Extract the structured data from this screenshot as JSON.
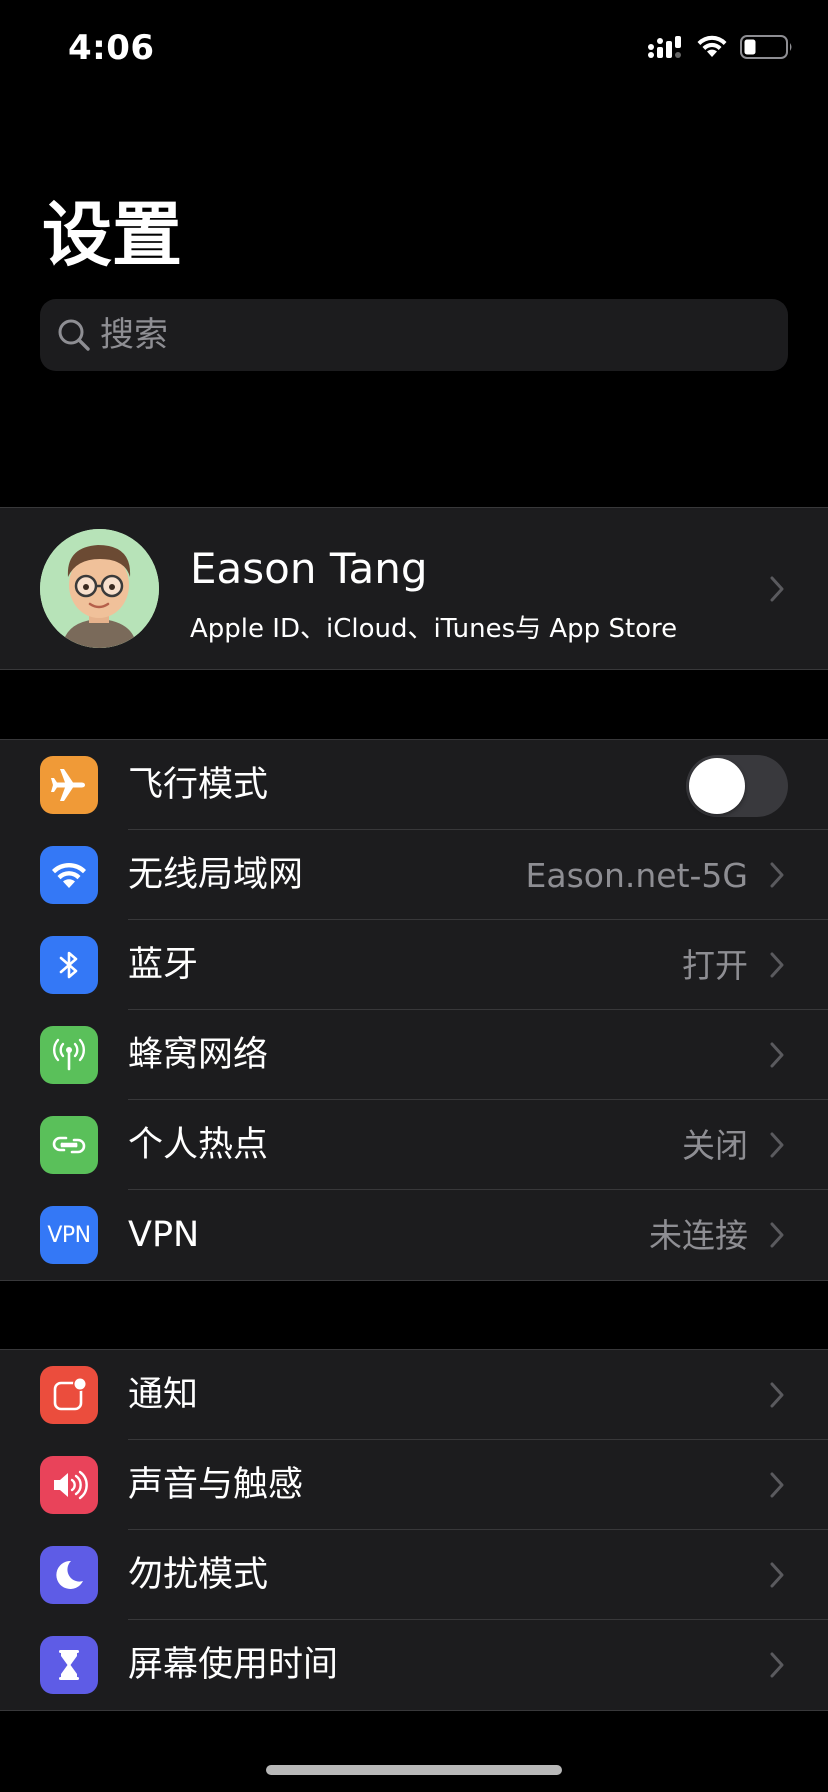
{
  "status_bar": {
    "time": "4:06"
  },
  "page": {
    "title": "设置"
  },
  "search": {
    "placeholder": "搜索"
  },
  "profile": {
    "name": "Eason Tang",
    "subtitle": "Apple ID、iCloud、iTunes与 App Store"
  },
  "network_group": [
    {
      "label": "飞行模式",
      "icon": "airplane-icon",
      "icon_color": "#f09a37",
      "toggle_on": false
    },
    {
      "label": "无线局域网",
      "value": "Eason.net-5G",
      "icon": "wifi-icon",
      "icon_color": "#3478f6"
    },
    {
      "label": "蓝牙",
      "value": "打开",
      "icon": "bluetooth-icon",
      "icon_color": "#3478f6"
    },
    {
      "label": "蜂窝网络",
      "value": "",
      "icon": "antenna-icon",
      "icon_color": "#5ac05a"
    },
    {
      "label": "个人热点",
      "value": "关闭",
      "icon": "hotspot-icon",
      "icon_color": "#5ac05a"
    },
    {
      "label": "VPN",
      "value": "未连接",
      "icon": "vpn-icon",
      "icon_text": "VPN",
      "icon_color": "#3478f6"
    }
  ],
  "notification_group": [
    {
      "label": "通知",
      "icon": "notification-icon",
      "icon_color": "#eb4d3d"
    },
    {
      "label": "声音与触感",
      "icon": "speaker-icon",
      "icon_color": "#e9435a"
    },
    {
      "label": "勿扰模式",
      "icon": "moon-icon",
      "icon_color": "#5e5ce6"
    },
    {
      "label": "屏幕使用时间",
      "icon": "hourglass-icon",
      "icon_color": "#5e5ce6"
    }
  ],
  "colors": {
    "background": "#000000",
    "cell": "#1c1c1e",
    "separator": "#38383a",
    "secondary_text": "#8e8e93"
  }
}
